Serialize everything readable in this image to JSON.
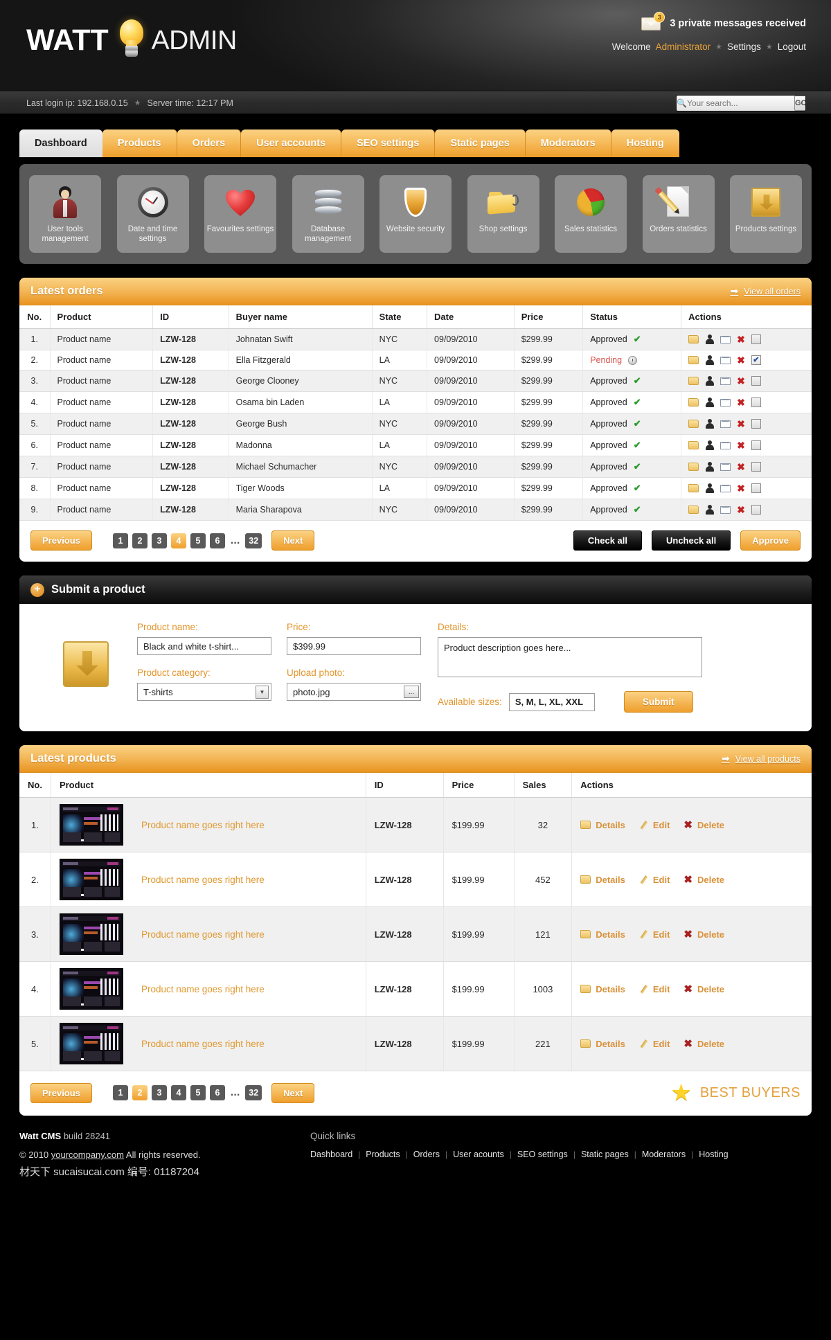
{
  "header": {
    "logo_watt": "WATT",
    "logo_admin": "ADMIN",
    "messages_count": "3",
    "messages_text": "3 private messages received",
    "welcome_label": "Welcome",
    "welcome_user": "Administrator",
    "settings_link": "Settings",
    "logout_link": "Logout"
  },
  "infobar": {
    "last_login": "Last login ip: 192.168.0.15",
    "server_time": "Server time: 12:17 PM",
    "search_placeholder": "Your search...",
    "search_value": "",
    "go_label": "GO"
  },
  "tabs": [
    {
      "label": "Dashboard",
      "active": true
    },
    {
      "label": "Products",
      "active": false
    },
    {
      "label": "Orders",
      "active": false
    },
    {
      "label": "User accounts",
      "active": false
    },
    {
      "label": "SEO settings",
      "active": false
    },
    {
      "label": "Static pages",
      "active": false
    },
    {
      "label": "Moderators",
      "active": false
    },
    {
      "label": "Hosting",
      "active": false
    }
  ],
  "shortcuts": [
    {
      "label": "User tools management",
      "icon": "user-tools-icon"
    },
    {
      "label": "Date and time settings",
      "icon": "clock-icon"
    },
    {
      "label": "Favourites settings",
      "icon": "heart-icon"
    },
    {
      "label": "Database management",
      "icon": "database-icon"
    },
    {
      "label": "Website security",
      "icon": "shield-icon"
    },
    {
      "label": "Shop settings",
      "icon": "folder-tag-icon"
    },
    {
      "label": "Sales statistics",
      "icon": "pie-chart-icon"
    },
    {
      "label": "Orders statistics",
      "icon": "pencil-document-icon"
    },
    {
      "label": "Products settings",
      "icon": "crate-icon"
    }
  ],
  "orders_panel": {
    "title": "Latest orders",
    "view_all": "View all orders",
    "columns": [
      "No.",
      "Product",
      "ID",
      "Buyer name",
      "State",
      "Date",
      "Price",
      "Status",
      "Actions"
    ],
    "rows": [
      {
        "no": "1.",
        "product": "Product name",
        "id": "LZW-128",
        "buyer": "Johnatan Swift",
        "state": "NYC",
        "date": "09/09/2010",
        "price": "$299.99",
        "status": "Approved",
        "checked": false
      },
      {
        "no": "2.",
        "product": "Product name",
        "id": "LZW-128",
        "buyer": "Ella Fitzgerald",
        "state": "LA",
        "date": "09/09/2010",
        "price": "$299.99",
        "status": "Pending",
        "checked": true
      },
      {
        "no": "3.",
        "product": "Product name",
        "id": "LZW-128",
        "buyer": "George Clooney",
        "state": "NYC",
        "date": "09/09/2010",
        "price": "$299.99",
        "status": "Approved",
        "checked": false
      },
      {
        "no": "4.",
        "product": "Product name",
        "id": "LZW-128",
        "buyer": "Osama bin Laden",
        "state": "LA",
        "date": "09/09/2010",
        "price": "$299.99",
        "status": "Approved",
        "checked": false
      },
      {
        "no": "5.",
        "product": "Product name",
        "id": "LZW-128",
        "buyer": "George Bush",
        "state": "NYC",
        "date": "09/09/2010",
        "price": "$299.99",
        "status": "Approved",
        "checked": false
      },
      {
        "no": "6.",
        "product": "Product name",
        "id": "LZW-128",
        "buyer": "Madonna",
        "state": "LA",
        "date": "09/09/2010",
        "price": "$299.99",
        "status": "Approved",
        "checked": false
      },
      {
        "no": "7.",
        "product": "Product name",
        "id": "LZW-128",
        "buyer": "Michael Schumacher",
        "state": "NYC",
        "date": "09/09/2010",
        "price": "$299.99",
        "status": "Approved",
        "checked": false
      },
      {
        "no": "8.",
        "product": "Product name",
        "id": "LZW-128",
        "buyer": "Tiger Woods",
        "state": "LA",
        "date": "09/09/2010",
        "price": "$299.99",
        "status": "Approved",
        "checked": false
      },
      {
        "no": "9.",
        "product": "Product name",
        "id": "LZW-128",
        "buyer": "Maria Sharapova",
        "state": "NYC",
        "date": "09/09/2010",
        "price": "$299.99",
        "status": "Approved",
        "checked": false
      }
    ],
    "pager": {
      "previous": "Previous",
      "next": "Next",
      "pages": [
        "1",
        "2",
        "3",
        "4",
        "5",
        "6"
      ],
      "dots": "...",
      "last_page": "32",
      "current": "4"
    },
    "check_all": "Check all",
    "uncheck_all": "Uncheck all",
    "approve": "Approve"
  },
  "submit_panel": {
    "title": "Submit a product",
    "product_name_label": "Product name:",
    "product_name_value": "Black and white t-shirt...",
    "product_category_label": "Product category:",
    "product_category_value": "T-shirts",
    "price_label": "Price:",
    "price_value": "$399.99",
    "upload_label": "Upload photo:",
    "upload_value": "photo.jpg",
    "browse_label": "...",
    "details_label": "Details:",
    "details_value": "Product description goes here...",
    "sizes_label": "Available sizes:",
    "sizes_value": "S, M, L, XL, XXL",
    "submit_label": "Submit"
  },
  "products_panel": {
    "title": "Latest products",
    "view_all": "View all products",
    "columns": [
      "No.",
      "Product",
      "ID",
      "Price",
      "Sales",
      "Actions"
    ],
    "action_labels": {
      "details": "Details",
      "edit": "Edit",
      "delete": "Delete"
    },
    "rows": [
      {
        "no": "1.",
        "name": "Product name goes right here",
        "id": "LZW-128",
        "price": "$199.99",
        "sales": "32"
      },
      {
        "no": "2.",
        "name": "Product name goes right here",
        "id": "LZW-128",
        "price": "$199.99",
        "sales": "452"
      },
      {
        "no": "3.",
        "name": "Product name goes right here",
        "id": "LZW-128",
        "price": "$199.99",
        "sales": "121"
      },
      {
        "no": "4.",
        "name": "Product name goes right here",
        "id": "LZW-128",
        "price": "$199.99",
        "sales": "1003"
      },
      {
        "no": "5.",
        "name": "Product name goes right here",
        "id": "LZW-128",
        "price": "$199.99",
        "sales": "221"
      }
    ],
    "pager": {
      "previous": "Previous",
      "next": "Next",
      "pages": [
        "1",
        "2",
        "3",
        "4",
        "5",
        "6"
      ],
      "dots": "...",
      "last_page": "32",
      "current": "2"
    },
    "best_buyers": "BEST BUYERS"
  },
  "footer": {
    "build": "build 28241",
    "brand": "Watt CMS",
    "copyright_pre": "© 2010",
    "copyright_link": "yourcompany.com",
    "copyright_post": "All rights reserved.",
    "watermark": "材天下 sucaisucai.com 编号: 01187204",
    "quick_links_title": "Quick links",
    "quick_links": [
      "Dashboard",
      "Products",
      "Orders",
      "User acounts",
      "SEO settings",
      "Static pages",
      "Moderators",
      "Hosting"
    ]
  },
  "colors": {
    "accent": "#ef9e2c",
    "accent_light": "#fbd283",
    "dark": "#000000",
    "pending": "#d8534f",
    "approved": "#2e9b2e"
  }
}
